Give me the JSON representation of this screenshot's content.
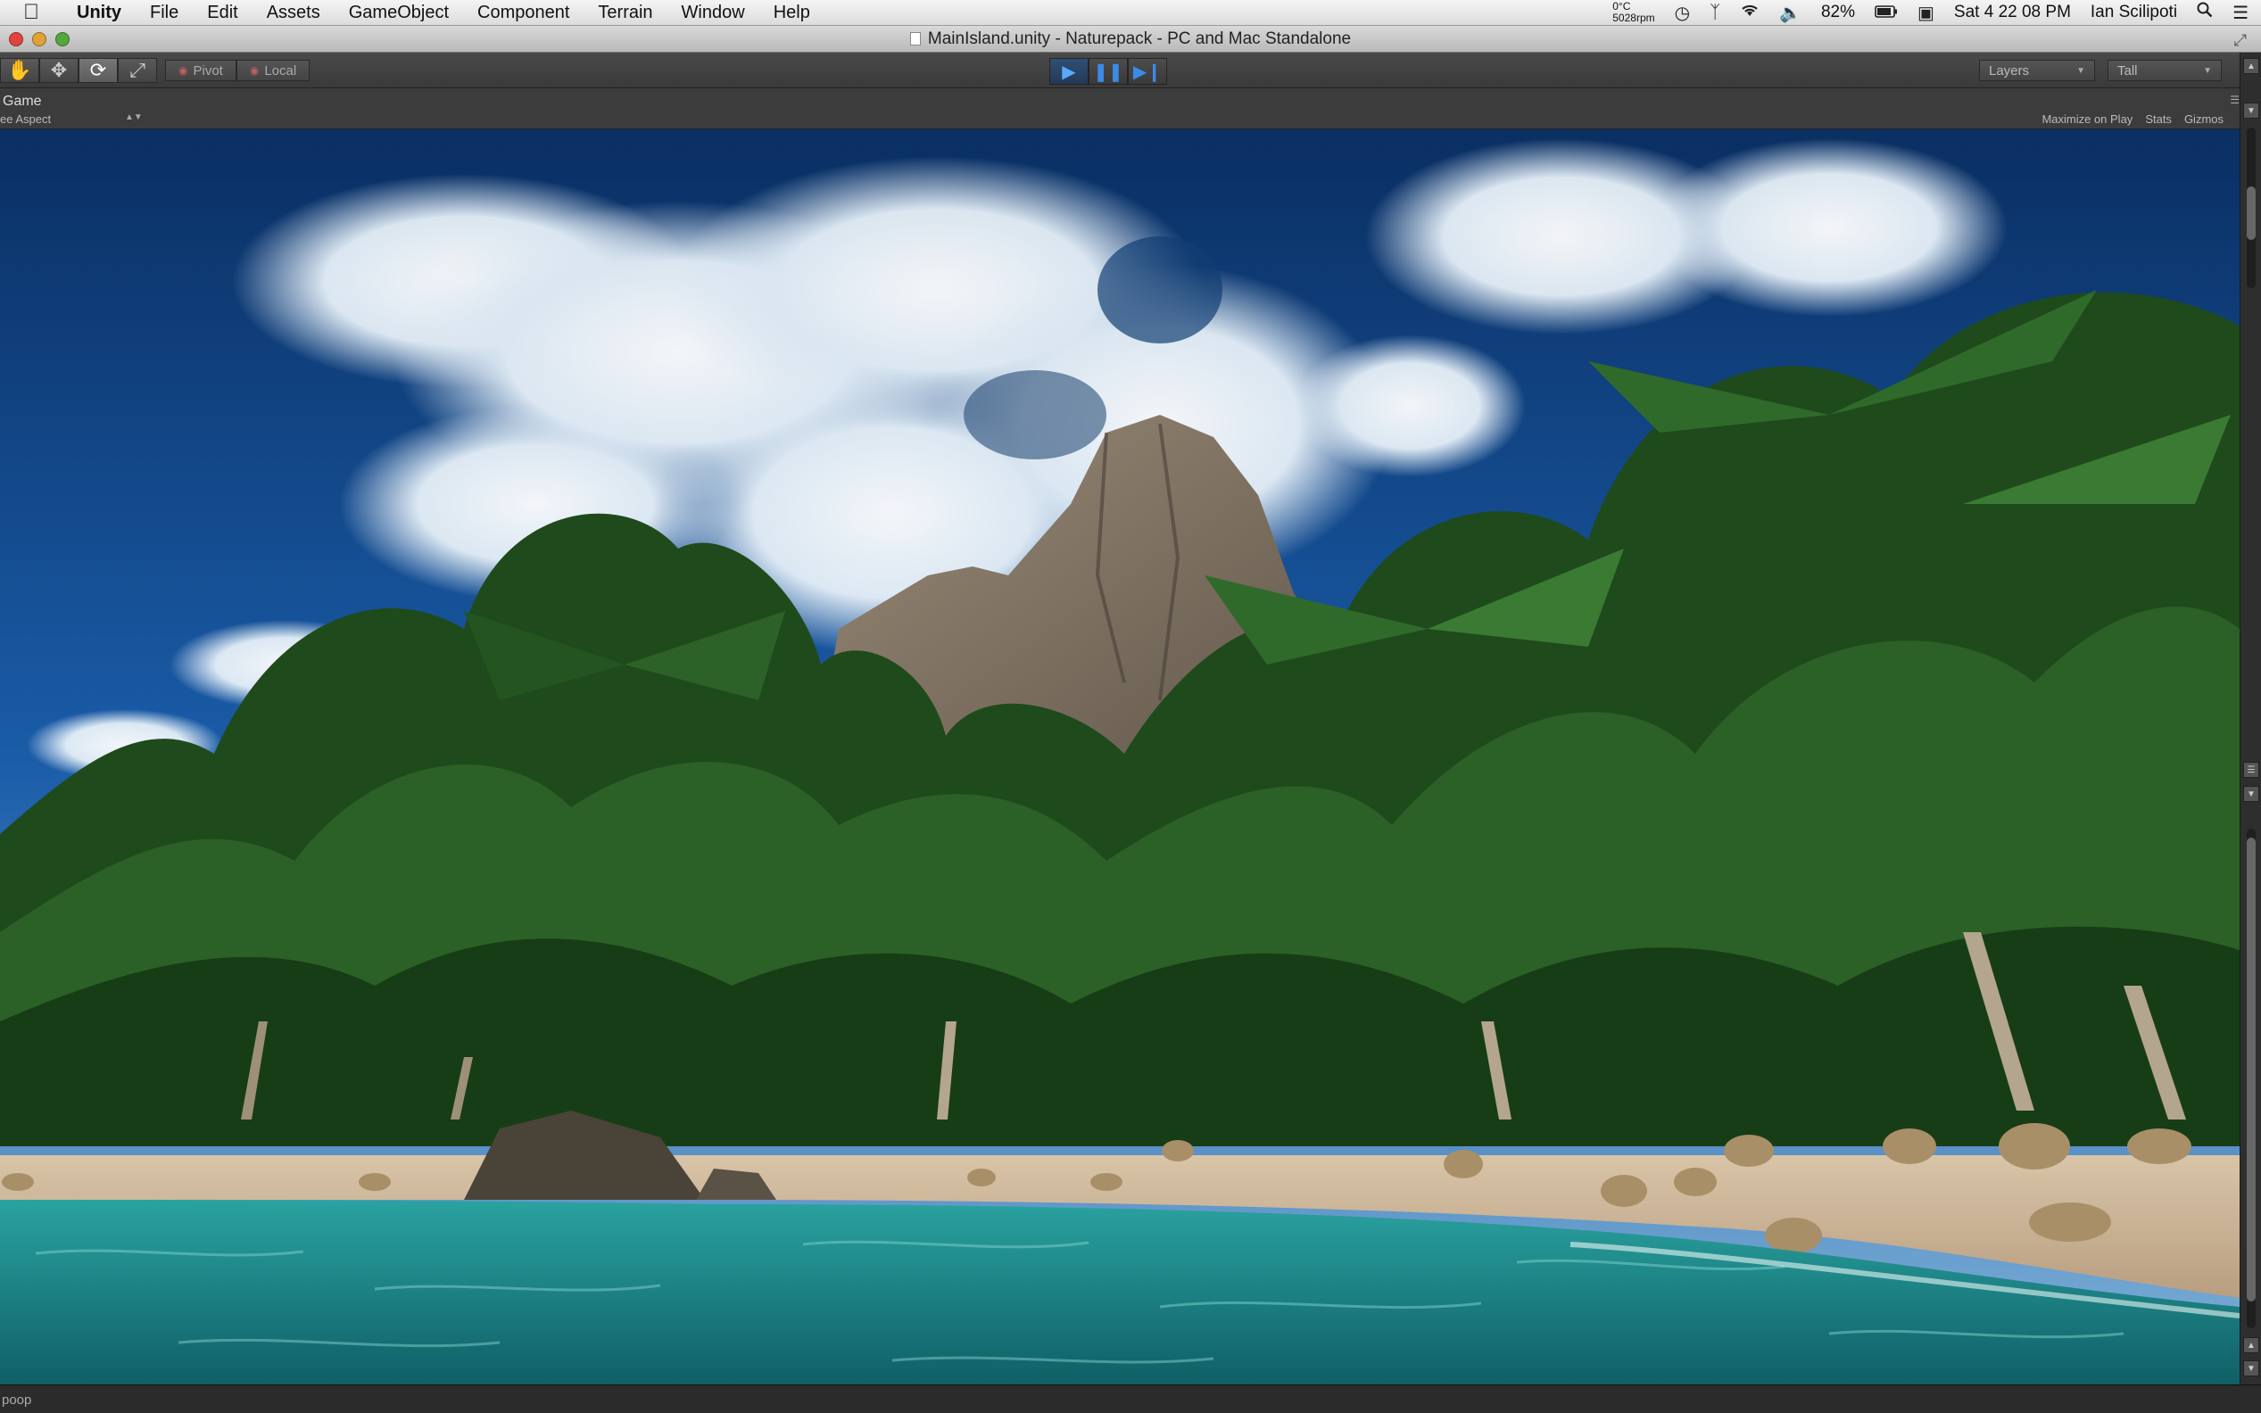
{
  "menubar": {
    "app": "Unity",
    "items": [
      "File",
      "Edit",
      "Assets",
      "GameObject",
      "Component",
      "Terrain",
      "Window",
      "Help"
    ],
    "status": {
      "temp": "0°C",
      "rpm": "5028rpm",
      "battery": "82%",
      "clock": "Sat 4 22 08 PM",
      "user": "Ian Scilipoti"
    }
  },
  "window": {
    "title": "MainIsland.unity - Naturepack - PC and Mac Standalone"
  },
  "toolbar": {
    "pivot_label": "Pivot",
    "local_label": "Local",
    "layers_label": "Layers",
    "layout_label": "Tall"
  },
  "game_view": {
    "tab_label": "Game",
    "aspect_label": "ee Aspect",
    "maximize_label": "Maximize on Play",
    "stats_label": "Stats",
    "gizmos_label": "Gizmos"
  },
  "status_bar": {
    "message": "poop"
  },
  "colors": {
    "sky": "#0e3e7a",
    "water": "#1f8c8c",
    "sand": "#c9b49a",
    "foliage": "#1e4a1c",
    "play_accent": "#3a8ce8"
  },
  "icons": {
    "apple": "apple-logo-icon",
    "hand_tool": "hand-tool-icon",
    "move_tool": "move-tool-icon",
    "rotate_tool": "rotate-tool-icon",
    "scale_tool": "scale-tool-icon",
    "play": "play-icon",
    "pause": "pause-icon",
    "step": "step-icon"
  }
}
